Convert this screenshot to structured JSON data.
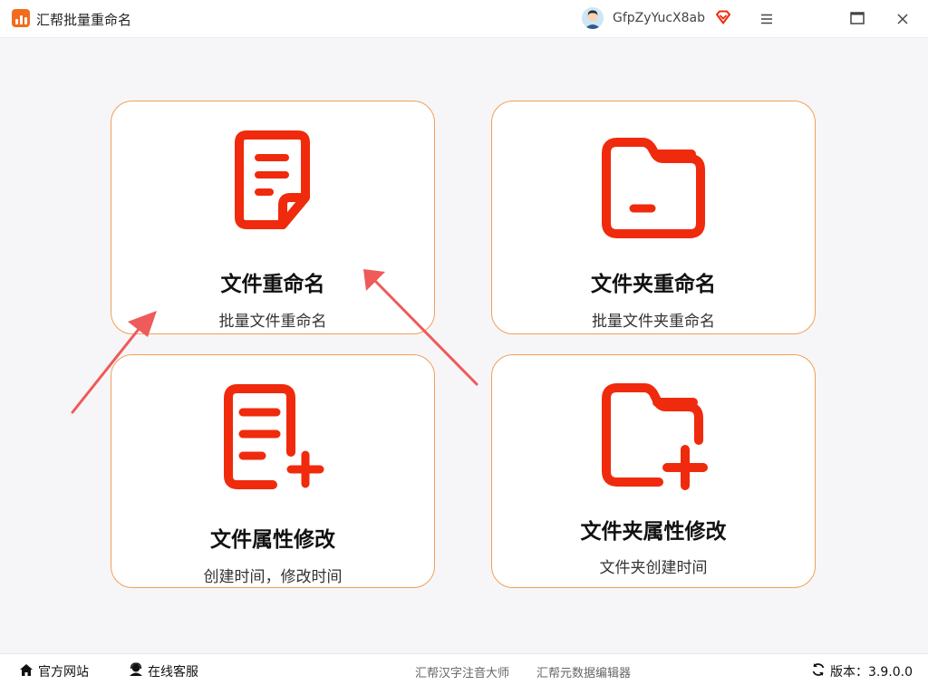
{
  "titlebar": {
    "app_name": "汇帮批量重命名",
    "username": "GfpZyYucX8ab",
    "icons": [
      "app-logo",
      "user-avatar",
      "vip-diamond-icon",
      "menu-icon",
      "maximize-icon",
      "close-icon"
    ]
  },
  "cards": [
    {
      "title": "文件重命名",
      "subtitle": "批量文件重命名",
      "icon": "document-icon"
    },
    {
      "title": "文件夹重命名",
      "subtitle": "批量文件夹重命名",
      "icon": "folder-icon"
    },
    {
      "title": "文件属性修改",
      "subtitle": "创建时间，修改时间",
      "icon": "document-add-icon"
    },
    {
      "title": "文件夹属性修改",
      "subtitle": "文件夹创建时间",
      "icon": "folder-add-icon"
    }
  ],
  "footer": {
    "website": "官方网站",
    "support": "在线客服",
    "link1": "汇帮汉字注音大师",
    "link2": "汇帮元数据编辑器",
    "version": "版本：3.9.0.0"
  },
  "colors": {
    "accent": "#f02a0c",
    "card_border": "#f1a057",
    "annotation_arrow": "#ef5a5a",
    "background": "#f6f6f8"
  }
}
